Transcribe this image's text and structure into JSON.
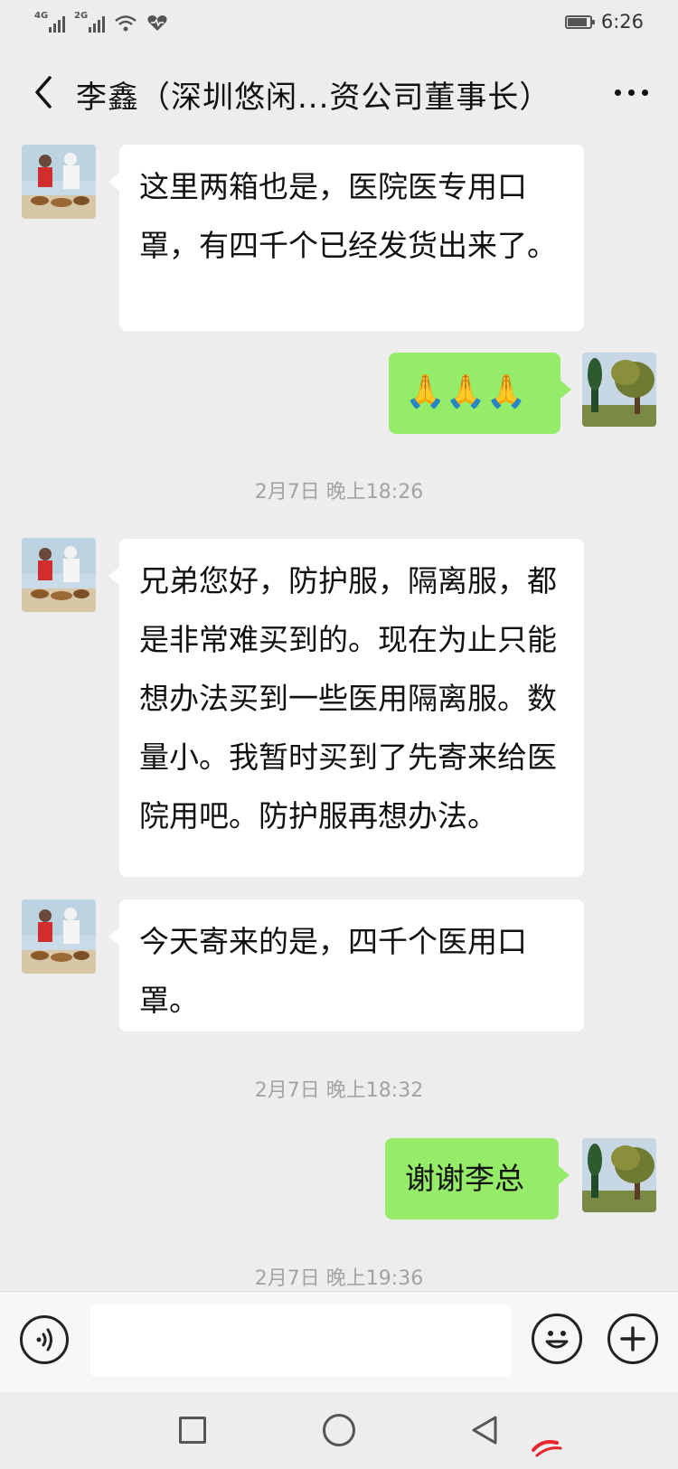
{
  "status_bar": {
    "signal_1_label": "4G",
    "signal_2_label": "2G",
    "time": "6:26"
  },
  "header": {
    "title": "李鑫（深圳悠闲...资公司董事长）"
  },
  "messages": [
    {
      "side": "in",
      "text": "这里两箱也是，医院医专用口罩，有四千个已经发货出来了。"
    },
    {
      "side": "out",
      "text": "🙏🙏🙏"
    },
    {
      "side": "in",
      "text": "兄弟您好，防护服，隔离服，都是非常难买到的。现在为止只能想办法买到一些医用隔离服。数量小。我暂时买到了先寄来给医院用吧。防护服再想办法。"
    },
    {
      "side": "in",
      "text": "今天寄来的是，四千个医用口罩。"
    },
    {
      "side": "out",
      "text": "谢谢李总"
    }
  ],
  "timestamps": [
    "2月7日 晚上18:26",
    "2月7日 晚上18:32",
    "2月7日 晚上19:36"
  ],
  "input_bar": {
    "text_value": "",
    "voice_icon": "voice-icon",
    "emoji_icon": "emoji-icon",
    "plus_icon": "plus-icon"
  },
  "colors": {
    "incoming_bubble": "#ffffff",
    "outgoing_bubble": "#95ec69",
    "background": "#ededed",
    "timestamp": "#a3a3a3"
  }
}
